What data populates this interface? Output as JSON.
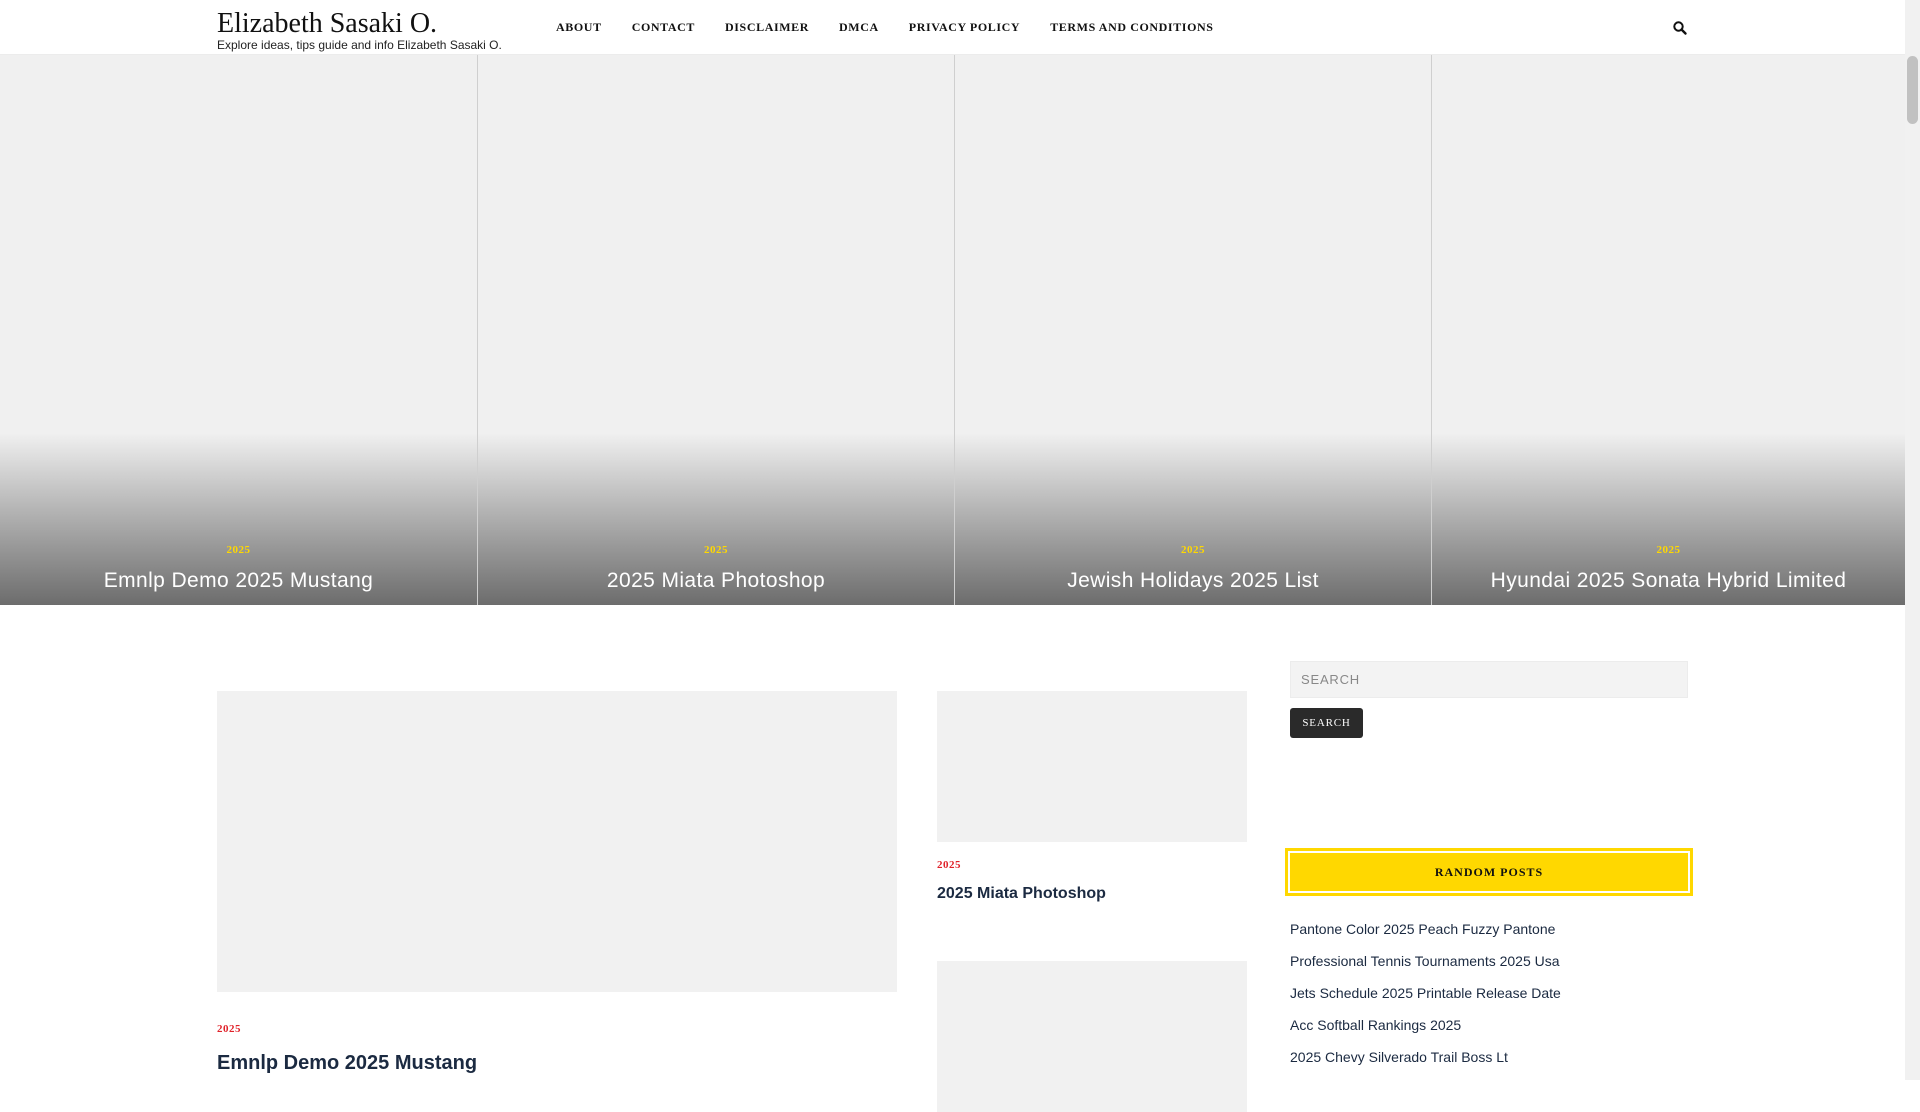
{
  "site": {
    "title": "Elizabeth Sasaki O.",
    "tagline": "Explore ideas, tips guide and info Elizabeth Sasaki O."
  },
  "nav": {
    "items": [
      "ABOUT",
      "CONTACT",
      "DISCLAIMER",
      "DMCA",
      "PRIVACY POLICY",
      "TERMS AND CONDITIONS"
    ]
  },
  "header_icons": {
    "search": "search-icon"
  },
  "slider": {
    "slides": [
      {
        "category": "2025",
        "title": "Emnlp Demo 2025 Mustang"
      },
      {
        "category": "2025",
        "title": "2025 Miata Photoshop"
      },
      {
        "category": "2025",
        "title": "Jewish Holidays 2025 List"
      },
      {
        "category": "2025",
        "title": "Hyundai 2025 Sonata Hybrid Limited"
      }
    ]
  },
  "main_post": {
    "category": "2025",
    "title": "Emnlp Demo 2025 Mustang"
  },
  "side_posts": [
    {
      "category": "2025",
      "title": "2025 Miata Photoshop"
    },
    {
      "category": "",
      "title": ""
    }
  ],
  "sidebar": {
    "search_placeholder": "SEARCH",
    "search_button": "SEARCH",
    "random_posts_heading": "RANDOM POSTS",
    "random_posts": [
      "Pantone Color 2025 Peach Fuzzy Pantone",
      "Professional Tennis Tournaments 2025 Usa",
      "Jets Schedule 2025 Printable Release Date",
      "Acc Softball Rankings 2025",
      "2025 Chevy Silverado Trail Boss Lt"
    ]
  },
  "colors": {
    "accent_yellow": "#ffd800",
    "category_red": "#e0222a",
    "title_navy": "#1b2a41",
    "placeholder_gray": "#f1f1f1"
  }
}
